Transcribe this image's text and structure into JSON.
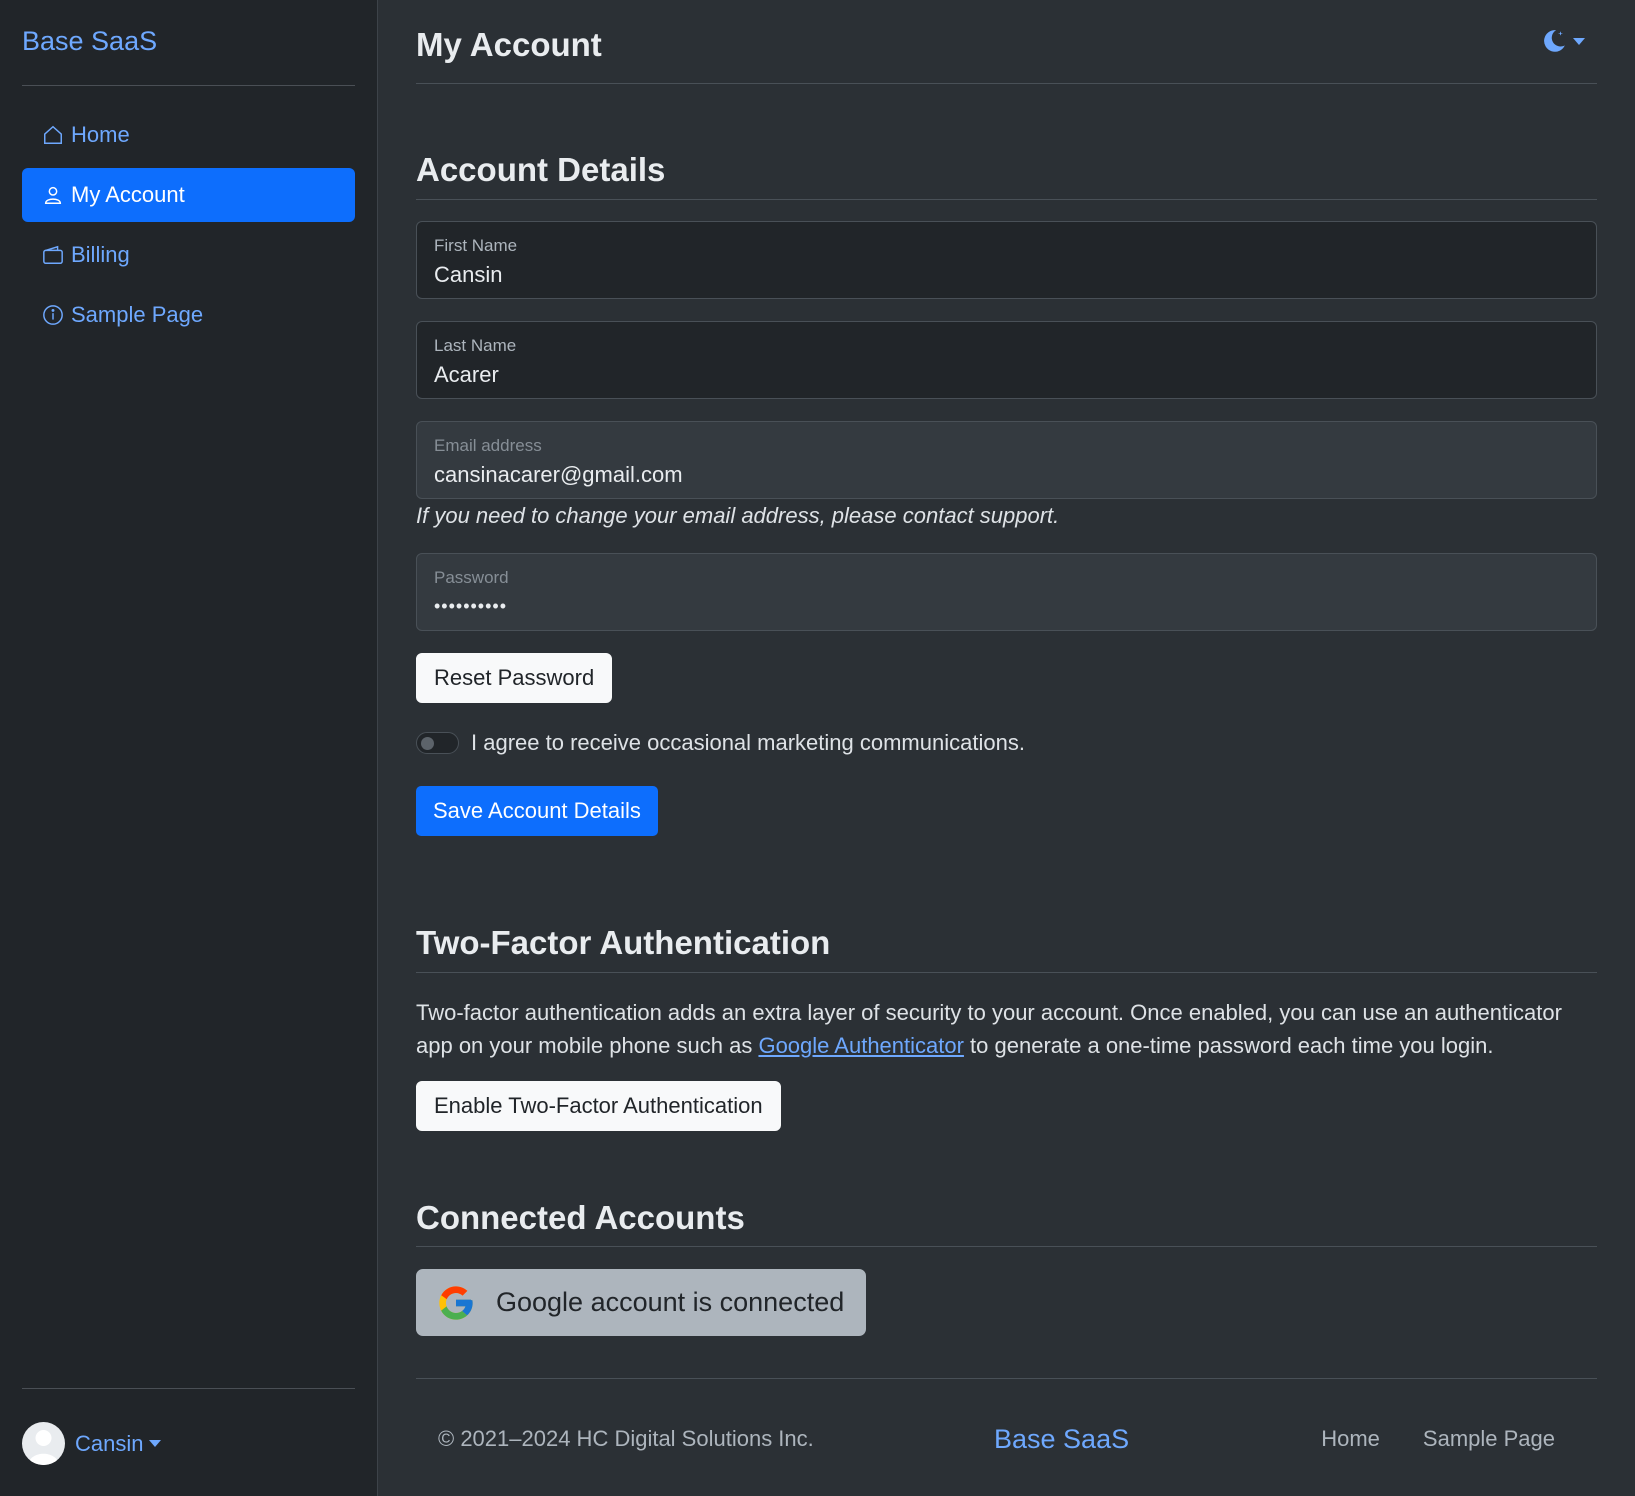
{
  "sidebar": {
    "brand": "Base SaaS",
    "items": [
      {
        "label": "Home",
        "icon": "house-icon"
      },
      {
        "label": "My Account",
        "icon": "person-icon",
        "active": true
      },
      {
        "label": "Billing",
        "icon": "wallet-icon"
      },
      {
        "label": "Sample Page",
        "icon": "info-circle-icon"
      }
    ],
    "user": {
      "name": "Cansin"
    }
  },
  "header": {
    "title": "My Account",
    "theme_icon": "moon-stars-icon"
  },
  "account_details": {
    "title": "Account Details",
    "first_name": {
      "label": "First Name",
      "value": "Cansin"
    },
    "last_name": {
      "label": "Last Name",
      "value": "Acarer"
    },
    "email": {
      "label": "Email address",
      "value": "cansinacarer@gmail.com"
    },
    "email_help": "If you need to change your email address, please contact support.",
    "password": {
      "label": "Password",
      "value": "••••••••••"
    },
    "reset_password_label": "Reset Password",
    "marketing_label": "I agree to receive occasional marketing communications.",
    "marketing_checked": false,
    "save_label": "Save Account Details"
  },
  "two_factor": {
    "title": "Two-Factor Authentication",
    "text_before": "Two-factor authentication adds an extra layer of security to your account. Once enabled, you can use an authenticator app on your mobile phone such as ",
    "link_text": "Google Authenticator",
    "text_after": " to generate a one-time password each time you login.",
    "enable_label": "Enable Two-Factor Authentication"
  },
  "connected_accounts": {
    "title": "Connected Accounts",
    "google_label": "Google account is connected"
  },
  "footer": {
    "copyright": "© 2021–2024 HC Digital Solutions Inc.",
    "brand": "Base SaaS",
    "links": [
      "Home",
      "Sample Page"
    ]
  },
  "colors": {
    "accent": "#0d6efd",
    "link": "#6ea8fe",
    "background": "#2b3035",
    "sidebar": "#212529"
  }
}
